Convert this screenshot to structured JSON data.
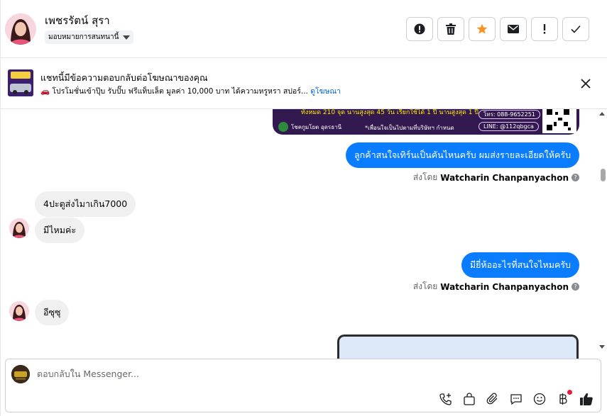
{
  "header": {
    "name": "เพชรรัตน์ สุรา",
    "assign_label": "มอบหมายการสนทนานี้"
  },
  "ad_banner": {
    "title": "แชทนี้มีข้อความตอบกลับต่อโฆษณาของคุณ",
    "subtitle": "🚗 โปรโมชั่นเข้าปุ๊บ รับปั๊บ ฟรีแท็บเล็ต มูลค่า 10,000 บาท ได้ความหรูหรา สปอร์...",
    "link": "ดูโฆษณา"
  },
  "ad_image": {
    "strip_text": "ทั้งหมด 210 จุด  นานสูงสุด 45 วัน  เรียกใช้ได้ 1 ปี  นานสูงสุด 1 ปี",
    "phone": "โทร: 088-9652251",
    "line": "LINE: @112qbgca",
    "brand": "โชคกูมโยต อุดรธานี",
    "tagline": "*เพื่อนใจเป็นไปตามที่บริษัทฯ กำหนด"
  },
  "messages": [
    {
      "dir": "out",
      "text": "ลูกค้าสนใจเทิร์นเป็นคันไหนครับ ผมส่งรายละเอียดให้ครับ"
    },
    {
      "dir": "in",
      "text": "4ปะตูส่งไมาเกิน7000"
    },
    {
      "dir": "in",
      "text": "มีไหมค่ะ"
    },
    {
      "dir": "out",
      "text": "มียี่ห้ออะไรที่สนใจไหมครับ"
    },
    {
      "dir": "in",
      "text": "อีซุซุ"
    }
  ],
  "sent_by": {
    "prefix": "ส่งโดย",
    "agent": "Watcharin Chanpanyachon"
  },
  "composer": {
    "placeholder": "ตอบกลับใน Messenger..."
  },
  "colors": {
    "outgoing_bubble": "#0a7cff",
    "incoming_bubble": "#f0f0f0",
    "star": "#f7931e",
    "link": "#0064d1"
  }
}
